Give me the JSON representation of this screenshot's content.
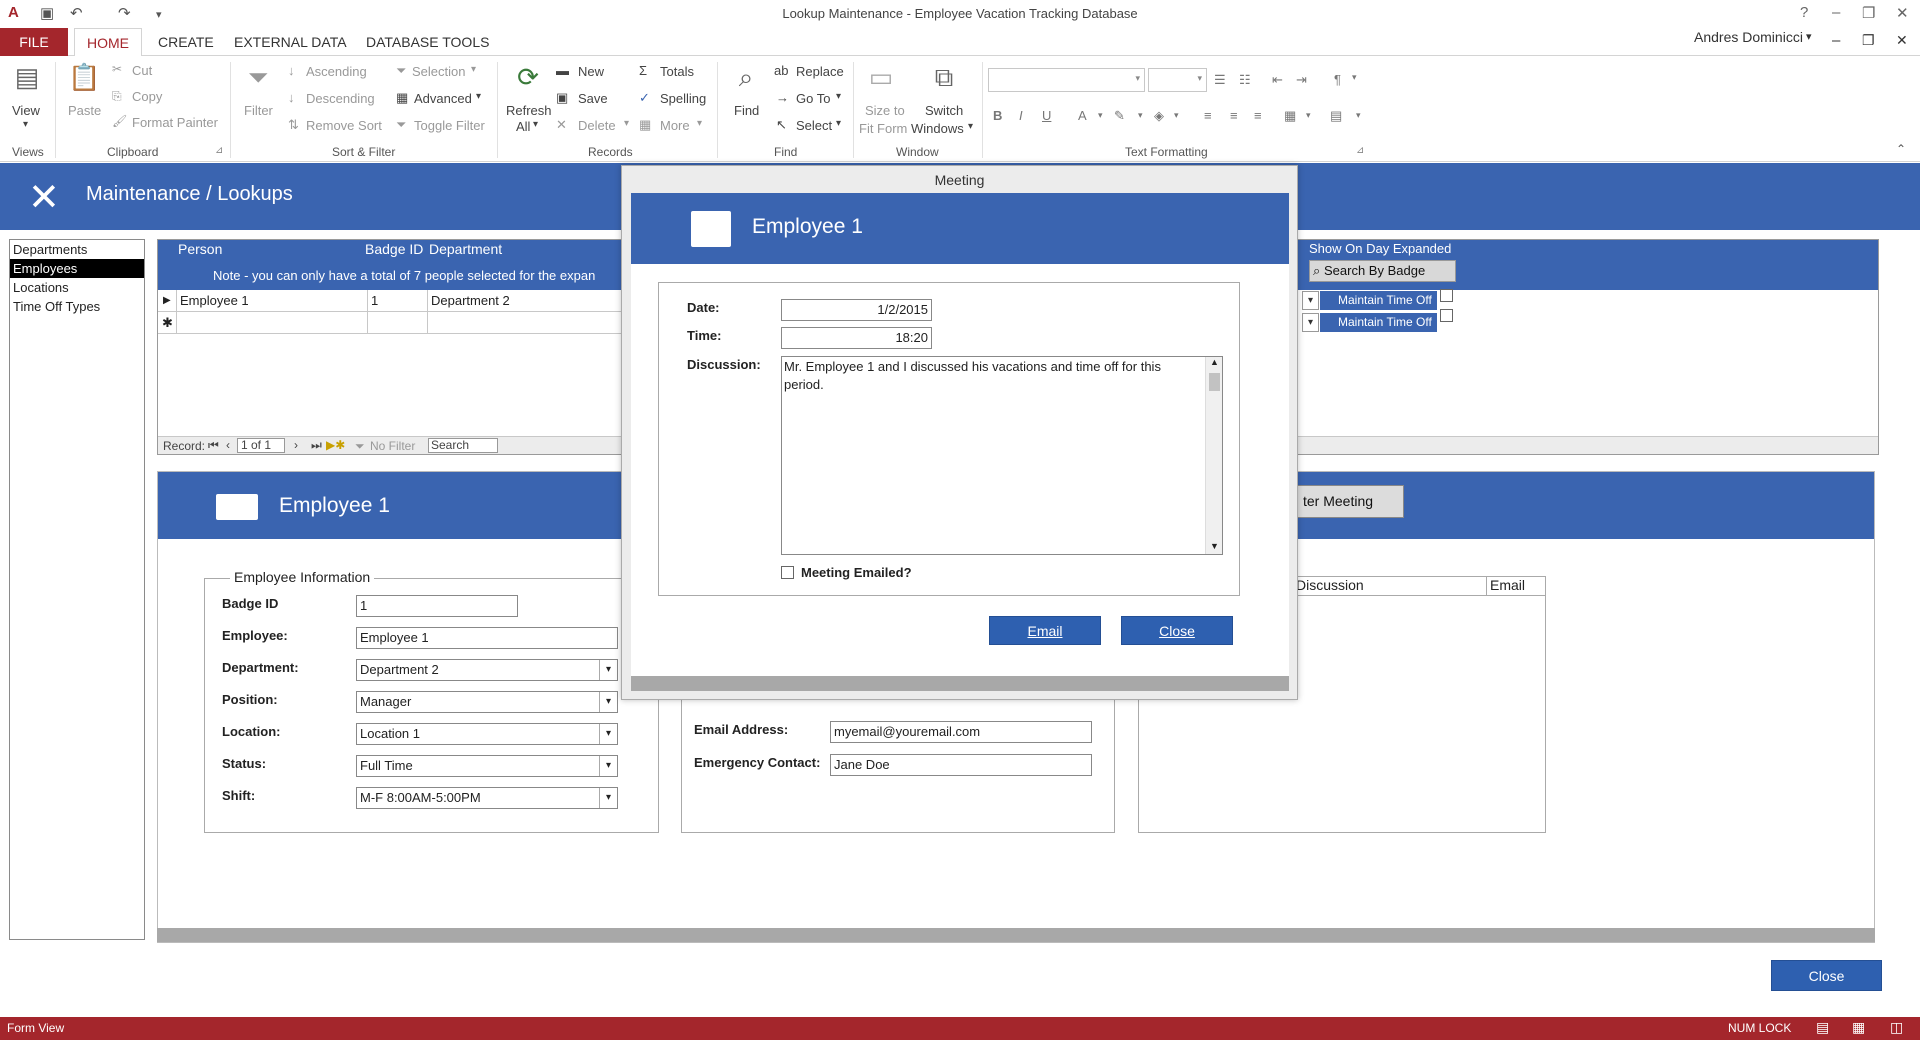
{
  "window": {
    "title": "Lookup Maintenance - Employee Vacation Tracking Database",
    "user": "Andres Dominicci",
    "user_caret": "▾"
  },
  "tabs": [
    "FILE",
    "HOME",
    "CREATE",
    "EXTERNAL DATA",
    "DATABASE TOOLS"
  ],
  "ribbon": {
    "views": {
      "view": "View",
      "group": "Views"
    },
    "clipboard": {
      "paste": "Paste",
      "cut": "Cut",
      "copy": "Copy",
      "format_painter": "Format Painter",
      "group": "Clipboard"
    },
    "sort_filter": {
      "filter": "Filter",
      "ascending": "Ascending",
      "descending": "Descending",
      "remove_sort": "Remove Sort",
      "selection": "Selection",
      "advanced": "Advanced",
      "toggle_filter": "Toggle Filter",
      "group": "Sort & Filter"
    },
    "records": {
      "refresh_line1": "Refresh",
      "refresh_line2": "All",
      "new": "New",
      "save": "Save",
      "delete": "Delete",
      "totals": "Totals",
      "spelling": "Spelling",
      "more": "More",
      "group": "Records"
    },
    "find": {
      "find": "Find",
      "replace": "Replace",
      "goto": "Go To",
      "select": "Select",
      "group": "Find"
    },
    "window": {
      "size_line1": "Size to",
      "size_line2": "Fit Form",
      "switch_line1": "Switch",
      "switch_line2": "Windows",
      "group": "Window"
    },
    "text_formatting": {
      "bold": "B",
      "italic": "I",
      "underline": "U",
      "font_color": "A",
      "group": "Text Formatting"
    }
  },
  "main_header": {
    "title": "Maintenance / Lookups"
  },
  "nav": [
    "Departments",
    "Employees",
    "Locations",
    "Time Off Types"
  ],
  "subform": {
    "headers": {
      "person": "Person",
      "badge": "Badge ID",
      "department": "Department",
      "show_on_day": "Show On Day Expanded"
    },
    "note": "Note - you can only have a total of 7 people selected for the expan",
    "search_by_badge": "Search By Badge",
    "rows": [
      {
        "selector": "▶",
        "person": "Employee 1",
        "badge": "1",
        "department": "Department 2"
      }
    ],
    "new_row_marker": "✱",
    "maintain_time_off": "Maintain Time Off",
    "record_nav": {
      "label": "Record:",
      "position": "1 of 1",
      "no_filter": "No Filter",
      "search": "Search"
    }
  },
  "employee_form": {
    "title": "Employee 1",
    "section": "Employee Information",
    "badge_label": "Badge ID",
    "badge": "1",
    "employee_label": "Employee:",
    "employee": "Employee 1",
    "department_label": "Department:",
    "department": "Department 2",
    "position_label": "Position:",
    "position": "Manager",
    "location_label": "Location:",
    "location": "Location 1",
    "status_label": "Status:",
    "status": "Full Time",
    "shift_label": "Shift:",
    "shift": "M-F 8:00AM-5:00PM",
    "email_label": "Email Address:",
    "email": "myemail@youremail.com",
    "emergency_label": "Emergency Contact:",
    "emergency": "Jane Doe",
    "enter_meeting": "ter Meeting",
    "meetings_cols": [
      "Discussion",
      "Email"
    ]
  },
  "close_main": "Close",
  "modal": {
    "window_title": "Meeting",
    "title": "Employee 1",
    "date_label": "Date:",
    "date": "1/2/2015",
    "time_label": "Time:",
    "time": "18:20",
    "discussion_label": "Discussion:",
    "discussion": "Mr. Employee 1 and I discussed his vacations and time off for this period.",
    "emailed_label": "Meeting Emailed?",
    "email_btn": "Email",
    "close_btn": "Close"
  },
  "status": {
    "view": "Form View",
    "numlock": "NUM LOCK"
  },
  "colors": {
    "accent": "#3a64b0",
    "file_tab": "#a4262c",
    "button": "#2e60b0"
  }
}
